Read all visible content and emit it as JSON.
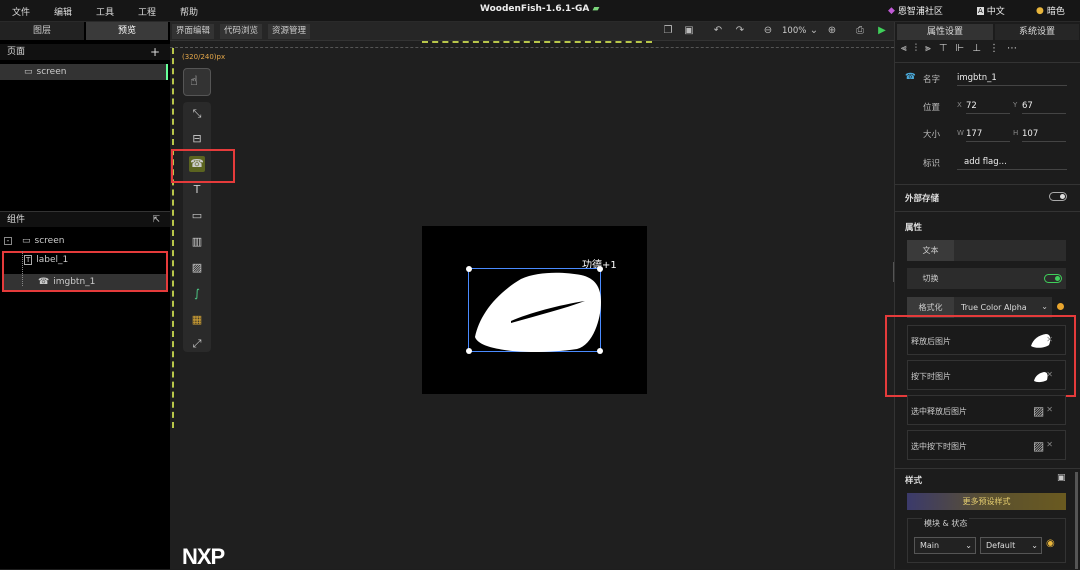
{
  "menubar": {
    "items": [
      "文件",
      "编辑",
      "工具",
      "工程",
      "帮助"
    ],
    "title": "WoodenFish-1.6.1-GA",
    "community": "恩智浦社区",
    "language": "中文",
    "theme": "暗色"
  },
  "left": {
    "tabs": [
      "图层",
      "预览"
    ],
    "pages_header": "页面",
    "page_item": "screen",
    "components_header": "组件",
    "tree_root": "screen",
    "tree_items": [
      "label_1",
      "imgbtn_1"
    ]
  },
  "center": {
    "tabs": [
      "界面编辑",
      "代码浏览",
      "资源管理"
    ],
    "zoom": "100%",
    "canvas_size": "(320/240)px",
    "canvas_label": "功德+1",
    "logo": "NXP"
  },
  "right": {
    "tabs": [
      "属性设置",
      "系统设置"
    ],
    "name_label": "名字",
    "name_value": "imgbtn_1",
    "pos_label": "位置",
    "x_label": "X",
    "x_value": "72",
    "y_label": "Y",
    "y_value": "67",
    "size_label": "大小",
    "w_label": "W",
    "w_value": "177",
    "h_label": "H",
    "h_value": "107",
    "flag_label": "标识",
    "flag_value": "add flag...",
    "storage_label": "外部存储",
    "attr_label": "属性",
    "text_label": "文本",
    "switch_label": "切换",
    "format_label": "格式化",
    "format_value": "True Color Alpha",
    "img_release": "释放后图片",
    "img_pressed": "按下时图片",
    "img_sel_release": "选中释放后图片",
    "img_sel_pressed": "选中按下时图片",
    "style_label": "样式",
    "more_styles": "更多预设样式",
    "part_state_label": "模块 & 状态",
    "part_value": "Main",
    "state_value": "Default"
  }
}
